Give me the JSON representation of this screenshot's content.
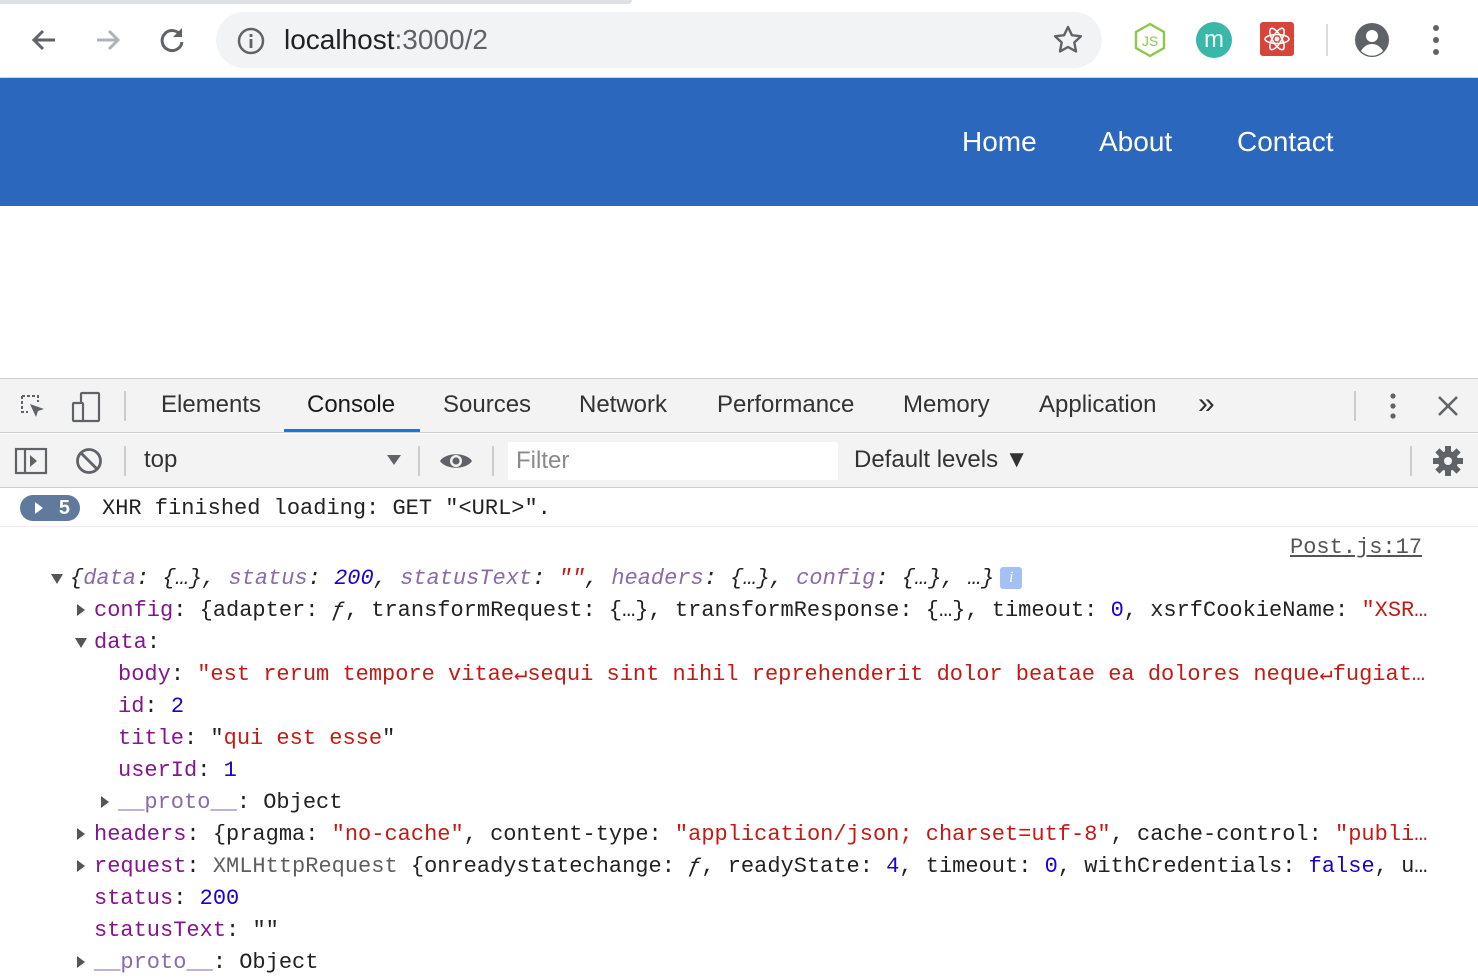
{
  "browser": {
    "url_host": "localhost",
    "url_path": ":3000/2"
  },
  "app": {
    "nav": [
      "Home",
      "About",
      "Contact"
    ],
    "primary_color": "#2b68bd"
  },
  "devtools": {
    "tabs": [
      "Elements",
      "Console",
      "Sources",
      "Network",
      "Performance",
      "Memory",
      "Application"
    ],
    "active_tab": "Console",
    "more_tabs": "»",
    "context": "top",
    "filter_placeholder": "Filter",
    "levels": "Default levels ▼",
    "messages": {
      "xhr_count": "5",
      "xhr_text": "XHR finished loading: GET \"<URL>\".",
      "source_link": "Post.js:17",
      "summary": {
        "open": "{",
        "data_key": "data",
        "data_val": "{…}",
        "status_key": "status",
        "status_val": "200",
        "statusText_key": "statusText",
        "statusText_val": "\"\"",
        "headers_key": "headers",
        "headers_val": "{…}",
        "config_key": "config",
        "config_val": "{…}",
        "close": "…}"
      },
      "config_line": {
        "key": "config",
        "p1": "{adapter: ",
        "f": "ƒ",
        "p2": ", transformRequest: {…}, transformResponse: {…}, timeout: ",
        "timeout": "0",
        "p3": ", xsrfCookieName: ",
        "xsrf": "\"XSR…"
      },
      "data_key": "data",
      "body_key": "body",
      "body_val": "\"est rerum tempore vitae↵sequi sint nihil reprehenderit dolor beatae ea dolores neque↵fugiat…",
      "id_key": "id",
      "id_val": "2",
      "title_key": "title",
      "title_val": "qui est esse",
      "userId_key": "userId",
      "userId_val": "1",
      "proto_key": "__proto__",
      "proto_val": "Object",
      "headers_line": {
        "key": "headers",
        "p1": "{pragma: ",
        "pragma": "\"no-cache\"",
        "p2": ", content-type: ",
        "ct": "\"application/json; charset=utf-8\"",
        "p3": ", cache-control: ",
        "cc": "\"publi…"
      },
      "request_line": {
        "key": "request",
        "cls": "XMLHttpRequest",
        "p1": " {onreadystatechange: ",
        "f": "ƒ",
        "p2": ", readyState: ",
        "rs": "4",
        "p3": ", timeout: ",
        "to": "0",
        "p4": ", withCredentials: ",
        "wc": "false",
        "p5": ", u…"
      },
      "status_key": "status",
      "status_val": "200",
      "statusText_key": "statusText",
      "statusText_val": "\"\"",
      "proto2_key": "__proto__",
      "proto2_val": "Object"
    }
  }
}
